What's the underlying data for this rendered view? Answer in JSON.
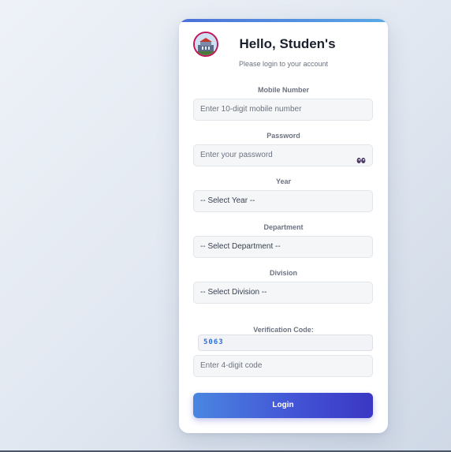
{
  "header": {
    "title": "Hello, Studen's",
    "subtitle": "Please login to your account"
  },
  "form": {
    "mobile": {
      "label": "Mobile Number",
      "placeholder": "Enter 10-digit mobile number"
    },
    "password": {
      "label": "Password",
      "placeholder": "Enter your password",
      "toggle_icon": "eye-icon"
    },
    "year": {
      "label": "Year",
      "selected": "-- Select Year --"
    },
    "department": {
      "label": "Department",
      "selected": "-- Select Department --"
    },
    "division": {
      "label": "Division",
      "selected": "-- Select Division --"
    },
    "verification": {
      "label": "Verification Code:",
      "code": "5063",
      "input_placeholder": "Enter 4-digit code"
    },
    "login_label": "Login"
  },
  "colors": {
    "accent_start": "#4a86e0",
    "accent_end": "#3a37c4",
    "code_text": "#2f6fd6",
    "logo_border": "#c2185b"
  }
}
